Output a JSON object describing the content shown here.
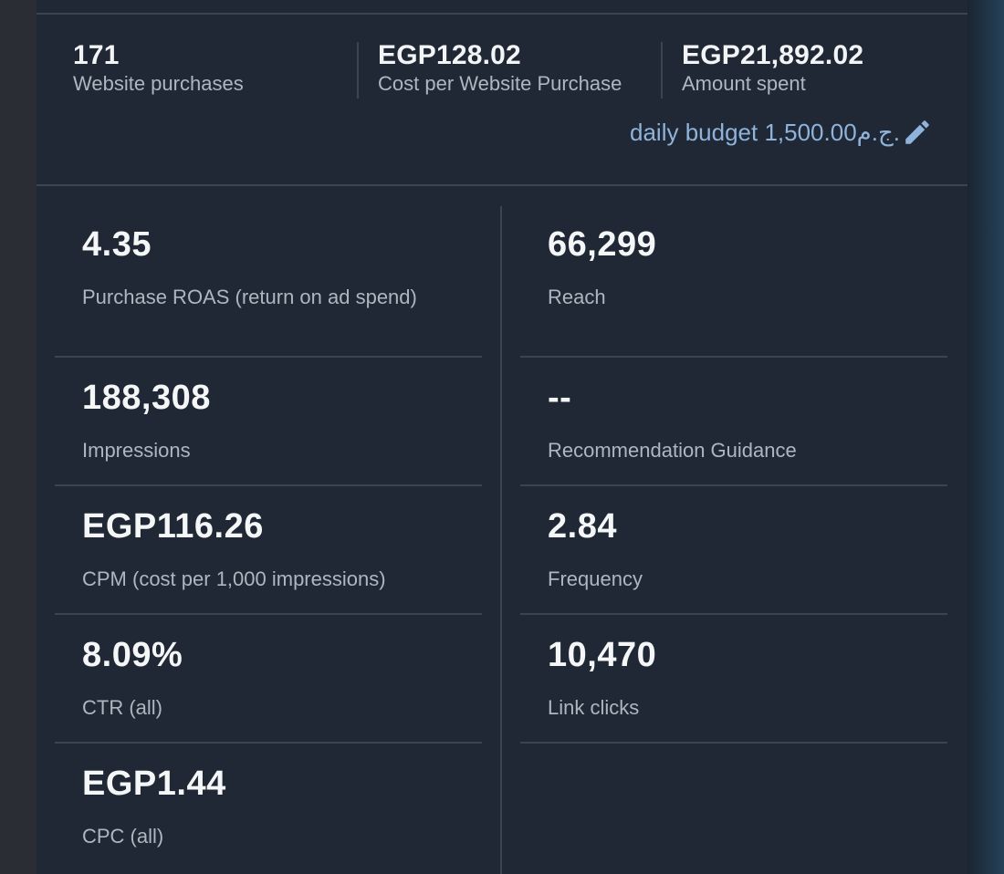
{
  "summary": [
    {
      "value": "171",
      "label": "Website purchases"
    },
    {
      "value": "EGP128.02",
      "label": "Cost per Website Purchase"
    },
    {
      "value": "EGP21,892.02",
      "label": "Amount spent"
    }
  ],
  "budget": {
    "text": "daily budget 1,500.00ج.م.",
    "edit_icon": "pencil-icon"
  },
  "metrics_left": [
    {
      "value": "4.35",
      "label": "Purchase ROAS (return on ad spend)"
    },
    {
      "value": "188,308",
      "label": "Impressions"
    },
    {
      "value": "EGP116.26",
      "label": "CPM (cost per 1,000 impressions)"
    },
    {
      "value": "8.09%",
      "label": "CTR (all)"
    },
    {
      "value": "EGP1.44",
      "label": "CPC (all)"
    }
  ],
  "metrics_right": [
    {
      "value": "66,299",
      "label": "Reach"
    },
    {
      "value": "--",
      "label": "Recommendation Guidance"
    },
    {
      "value": "2.84",
      "label": "Frequency"
    },
    {
      "value": "10,470",
      "label": "Link clicks"
    }
  ],
  "colors": {
    "panel_bg": "#1f2834",
    "link": "#8fb3da",
    "value_text": "#f4f6f8",
    "label_text": "#aeb6c0",
    "divider": "#3a4452"
  }
}
